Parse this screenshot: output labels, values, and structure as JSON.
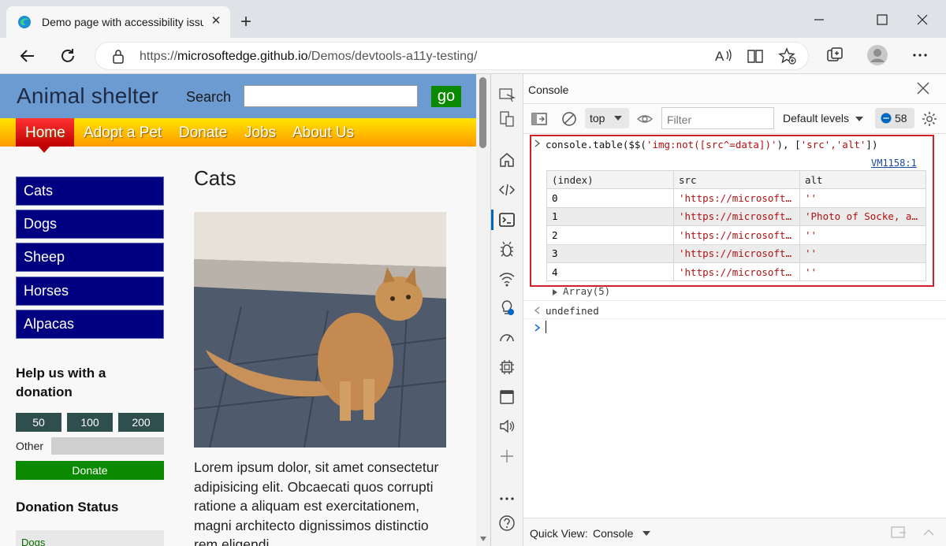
{
  "browser": {
    "tab_title": "Demo page with accessibility issues",
    "url_prefix": "https://",
    "url_host": "microsoftedge.github.io",
    "url_path": "/Demos/devtools-a11y-testing/"
  },
  "page": {
    "site_title": "Animal shelter",
    "search_label": "Search",
    "search_value": "",
    "go_label": "go",
    "nav": [
      "Home",
      "Adopt a Pet",
      "Donate",
      "Jobs",
      "About Us"
    ],
    "sidebar": [
      "Cats",
      "Dogs",
      "Sheep",
      "Horses",
      "Alpacas"
    ],
    "donation_heading": "Help us with a donation",
    "amounts": [
      "50",
      "100",
      "200"
    ],
    "other_label": "Other",
    "donate_button": "Donate",
    "status_heading": "Donation Status",
    "status_first": "Dogs",
    "main_heading": "Cats",
    "lorem": "Lorem ipsum dolor, sit amet consectetur adipisicing elit. Obcaecati quos corrupti ratione a aliquam est exercitationem, magni architecto dignissimos distinctio rem eligendi"
  },
  "devtools": {
    "panel_title": "Console",
    "context": "top",
    "filter_placeholder": "Filter",
    "levels": "Default levels",
    "message_count": "58",
    "command_prefix": "console.table($$(",
    "command_selector": "'img:not([src^=data])'",
    "command_sep": "), [",
    "command_cols": "'src','alt'",
    "command_suffix": "])",
    "source_link": "VM1158:1",
    "table_headers": [
      "(index)",
      "src",
      "alt"
    ],
    "table_rows": [
      {
        "index": "0",
        "src": "'https://microsoft…",
        "alt": "''"
      },
      {
        "index": "1",
        "src": "'https://microsoft…",
        "alt": "'Photo of Socke, a…"
      },
      {
        "index": "2",
        "src": "'https://microsoft…",
        "alt": "''"
      },
      {
        "index": "3",
        "src": "'https://microsoft…",
        "alt": "''"
      },
      {
        "index": "4",
        "src": "'https://microsoft…",
        "alt": "''"
      }
    ],
    "array_summary": "Array(5)",
    "result": "undefined",
    "quick_view_label": "Quick View:",
    "quick_view_value": "Console"
  },
  "icons": {
    "back": "back-arrow-icon",
    "refresh": "refresh-icon",
    "lock": "lock-icon",
    "read_aloud": "read-aloud-icon",
    "reader": "immersive-reader-icon",
    "favorites": "add-favorite-icon",
    "collections": "collections-icon",
    "profile": "profile-icon",
    "more": "more-icon"
  },
  "colors": {
    "header_blue": "#6b9bd1",
    "nav_active_red": "#c00000",
    "sidebar_navy": "#000080",
    "go_green": "#0b8a00",
    "highlight_red": "#d0202a",
    "devtools_accent": "#0067c0"
  }
}
